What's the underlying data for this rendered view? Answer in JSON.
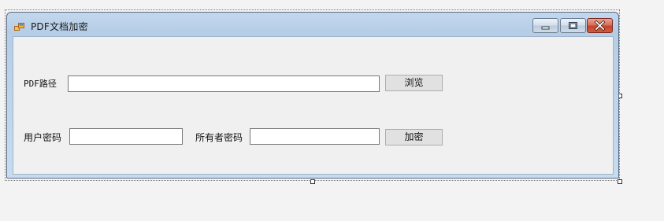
{
  "window": {
    "title": "PDF文档加密",
    "icon": "app-window-icon",
    "controls": {
      "minimize": "minimize-icon",
      "maximize": "maximize-icon",
      "close": "close-icon"
    }
  },
  "form": {
    "path_label": "PDF路径",
    "path_value": "",
    "browse_label": "浏览",
    "user_password_label": "用户密码",
    "user_password_value": "",
    "owner_password_label": "所有者密码",
    "owner_password_value": "",
    "encrypt_label": "加密"
  },
  "colors": {
    "frame": "#c3d8ee",
    "client": "#f0f0f0",
    "close_button": "#c5432b"
  }
}
